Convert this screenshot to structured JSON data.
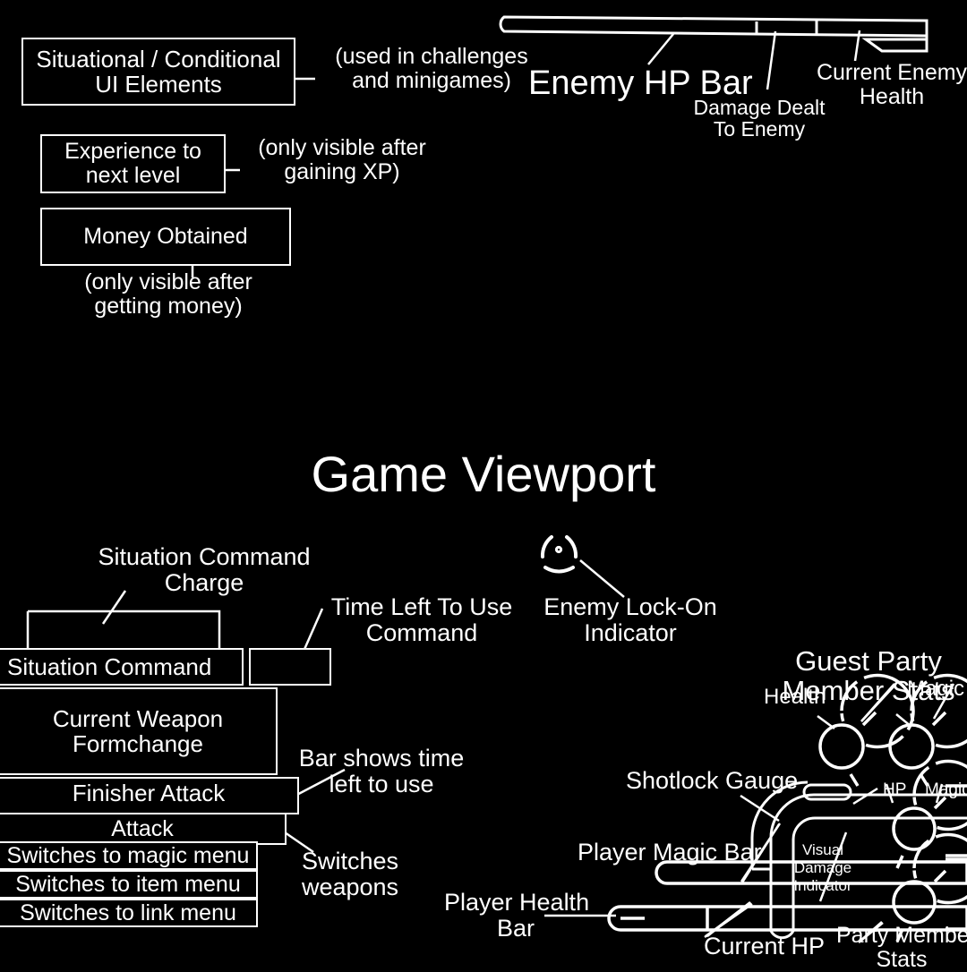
{
  "meta": {
    "title": "Game Viewport",
    "bg_color": "#000000",
    "stroke_color": "#ffffff"
  },
  "conditional_section": {
    "boxes": [
      {
        "id": "situational-conditional",
        "label": "Situational / Conditional\nUI Elements"
      },
      {
        "id": "experience-to-next-level",
        "label": "Experience to\nnext level"
      },
      {
        "id": "money-obtained",
        "label": "Money Obtained"
      }
    ],
    "notes": [
      {
        "id": "used-in-challenges",
        "label": "(used in challenges\nand minigames)"
      },
      {
        "id": "only-visible-after-gaining-xp",
        "label": "(only visible after\ngaining XP)"
      },
      {
        "id": "only-visible-after-getting-money",
        "label": "(only visible after\ngetting money)"
      }
    ]
  },
  "enemy_hp": {
    "title": "Enemy HP Bar",
    "damage_dealt": "Damage Dealt\nTo Enemy",
    "current_enemy_health": "Current Enemy\nHealth"
  },
  "viewport": {
    "title": "Game Viewport",
    "lock_on_label": "Enemy Lock-On\nIndicator",
    "lock_on_icon": "lock-on-reticle-icon"
  },
  "situation_command": {
    "charge_label": "Situation Command\nCharge",
    "time_left_label": "Time Left To Use\nCommand",
    "bar_shows_time_label": "Bar shows time\nleft to use",
    "switches_weapons_label": "Switches\nweapons",
    "rows": [
      {
        "id": "situation-command",
        "label": "Situation Command"
      },
      {
        "id": "current-weapon-formchange",
        "label": "Current Weapon\nFormchange"
      },
      {
        "id": "finisher-attack",
        "label": "Finisher Attack"
      },
      {
        "id": "attack",
        "label": "Attack"
      },
      {
        "id": "magic-menu",
        "label": "Switches to magic menu"
      },
      {
        "id": "item-menu",
        "label": "Switches to item menu"
      },
      {
        "id": "link-menu",
        "label": "Switches to link menu"
      }
    ],
    "cursor_icon": "cursor-triangle-icon"
  },
  "player_hud": {
    "guest_party_title": "Guest Party\nMember Stats",
    "guest_health_label": "Health",
    "guest_magic_label": "Magic",
    "shotlock_label": "Shotlock Gauge",
    "player_magic_label": "Player Magic Bar",
    "player_health_label": "Player Health\nBar",
    "current_hp_label": "Current HP",
    "visual_damage_label": "Visual\nDamage\nIndicator",
    "party_hp_label": "HP",
    "party_magic_label": "Magic",
    "party_member_stats_label": "Party Member\nStats"
  }
}
